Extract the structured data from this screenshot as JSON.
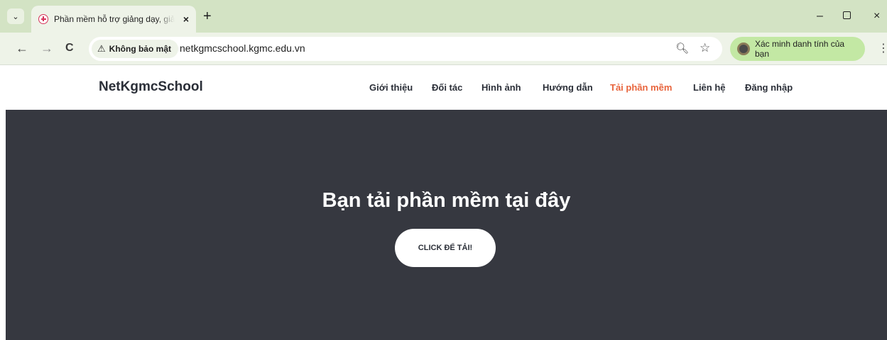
{
  "browser": {
    "tab_title": "Phần mềm hỗ trợ giảng dạy, giả",
    "tab_close": "×",
    "new_tab": "+",
    "window_min": "–",
    "window_close": "×",
    "back": "←",
    "forward": "→",
    "reload": "C",
    "security_label": "Không bảo mật",
    "url": "netkgmcschool.kgmc.edu.vn",
    "verify_label": "Xác minh danh tính của bạn",
    "menu": "⋮"
  },
  "site": {
    "brand": "NetKgmcSchool",
    "nav": [
      {
        "label": "Giới thiệu",
        "active": false
      },
      {
        "label": "Đối tác",
        "active": false
      },
      {
        "label": "Hình ảnh",
        "active": false
      },
      {
        "label": "Hướng dẫn",
        "active": false
      },
      {
        "label": "Tải phần mềm",
        "active": true
      },
      {
        "label": "Liên hệ",
        "active": false
      },
      {
        "label": "Đăng nhập",
        "active": false
      }
    ],
    "hero_title": "Bạn tải phần mềm tại đây",
    "hero_button": "CLICK ĐỂ TẢI!"
  },
  "colors": {
    "tabstrip": "#d3e3c4",
    "hero_bg": "#363840",
    "accent": "#e8643c",
    "verify_pill": "#c3e8a4"
  }
}
